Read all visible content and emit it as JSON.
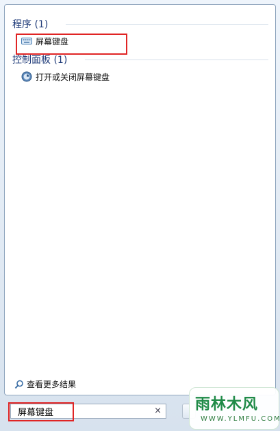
{
  "sections": {
    "programs": {
      "title": "程序 (1)"
    },
    "control_panel": {
      "title": "控制面板 (1)"
    }
  },
  "results": {
    "programs": [
      {
        "label": "屏幕键盘",
        "icon": "keyboard-icon"
      }
    ],
    "control_panel": [
      {
        "label": "打开或关闭屏幕键盘",
        "icon": "ease-of-access-icon"
      }
    ]
  },
  "see_more": {
    "label": "查看更多结果",
    "icon": "search-icon"
  },
  "search": {
    "value": "屏幕键盘",
    "clear_symbol": "×"
  },
  "watermark": {
    "text": "雨林木风",
    "url_text": "WWW.YLMFU.COM"
  },
  "colors": {
    "highlight": "#e02424",
    "section_title": "#1e3a78"
  }
}
